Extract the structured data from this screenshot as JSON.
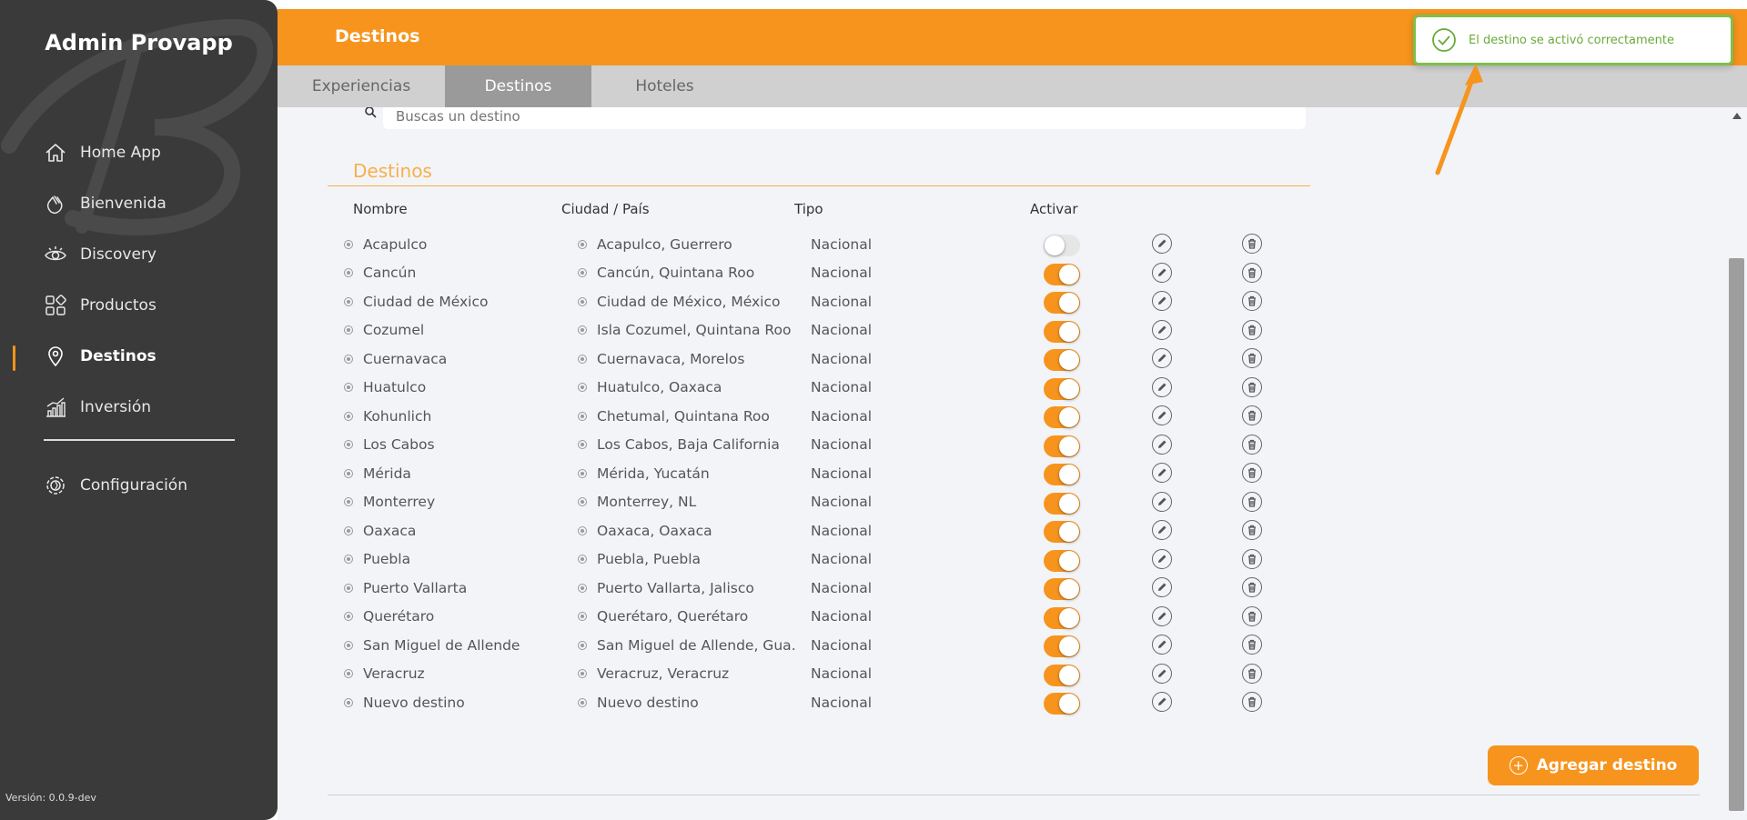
{
  "sidebar": {
    "title": "Admin Provapp",
    "items": [
      {
        "label": "Home App",
        "icon": "home-icon"
      },
      {
        "label": "Bienvenida",
        "icon": "waving-hand-icon"
      },
      {
        "label": "Discovery",
        "icon": "eye-icon"
      },
      {
        "label": "Productos",
        "icon": "grid-icon"
      },
      {
        "label": "Destinos",
        "icon": "location-pin-icon",
        "active": true
      },
      {
        "label": "Inversión",
        "icon": "bar-chart-icon"
      }
    ],
    "config": {
      "label": "Configuración",
      "icon": "gear-icon"
    },
    "version": "Versión: 0.0.9-dev"
  },
  "header": {
    "title": "Destinos"
  },
  "tabs": [
    {
      "label": "Experiencias"
    },
    {
      "label": "Destinos",
      "active": true
    },
    {
      "label": "Hoteles"
    }
  ],
  "search": {
    "placeholder": "Buscas un destino"
  },
  "section": {
    "title": "Destinos"
  },
  "table": {
    "headers": {
      "name": "Nombre",
      "city": "Ciudad / País",
      "tipo": "Tipo",
      "activar": "Activar"
    },
    "rows": [
      {
        "name": "Acapulco",
        "city": "Acapulco, Guerrero",
        "tipo": "Nacional",
        "active": false
      },
      {
        "name": "Cancún",
        "city": "Cancún, Quintana Roo",
        "tipo": "Nacional",
        "active": true
      },
      {
        "name": "Ciudad de México",
        "city": "Ciudad de México, México",
        "tipo": "Nacional",
        "active": true
      },
      {
        "name": "Cozumel",
        "city": "Isla Cozumel, Quintana Roo",
        "tipo": "Nacional",
        "active": true
      },
      {
        "name": "Cuernavaca",
        "city": "Cuernavaca, Morelos",
        "tipo": "Nacional",
        "active": true
      },
      {
        "name": "Huatulco",
        "city": "Huatulco, Oaxaca",
        "tipo": "Nacional",
        "active": true
      },
      {
        "name": "Kohunlich",
        "city": "Chetumal, Quintana Roo",
        "tipo": "Nacional",
        "active": true
      },
      {
        "name": "Los Cabos",
        "city": "Los Cabos, Baja California",
        "tipo": "Nacional",
        "active": true
      },
      {
        "name": "Mérida",
        "city": "Mérida, Yucatán",
        "tipo": "Nacional",
        "active": true
      },
      {
        "name": "Monterrey",
        "city": "Monterrey, NL",
        "tipo": "Nacional",
        "active": true
      },
      {
        "name": "Oaxaca",
        "city": "Oaxaca, Oaxaca",
        "tipo": "Nacional",
        "active": true
      },
      {
        "name": "Puebla",
        "city": "Puebla, Puebla",
        "tipo": "Nacional",
        "active": true
      },
      {
        "name": "Puerto Vallarta",
        "city": "Puerto Vallarta, Jalisco",
        "tipo": "Nacional",
        "active": true
      },
      {
        "name": "Querétaro",
        "city": "Querétaro, Querétaro",
        "tipo": "Nacional",
        "active": true
      },
      {
        "name": "San Miguel de Allende",
        "city": "San Miguel de Allende, Gua…",
        "tipo": "Nacional",
        "active": true
      },
      {
        "name": "Veracruz",
        "city": "Veracruz, Veracruz",
        "tipo": "Nacional",
        "active": true
      },
      {
        "name": "Nuevo destino",
        "city": "Nuevo destino",
        "tipo": "Nacional",
        "active": true
      }
    ]
  },
  "add_button": {
    "label": "Agregar destino"
  },
  "toast": {
    "message": "El destino se activó correctamente"
  },
  "colors": {
    "accent": "#f7941d",
    "sidebar": "#3a3a3a",
    "success": "#7cc04b"
  }
}
